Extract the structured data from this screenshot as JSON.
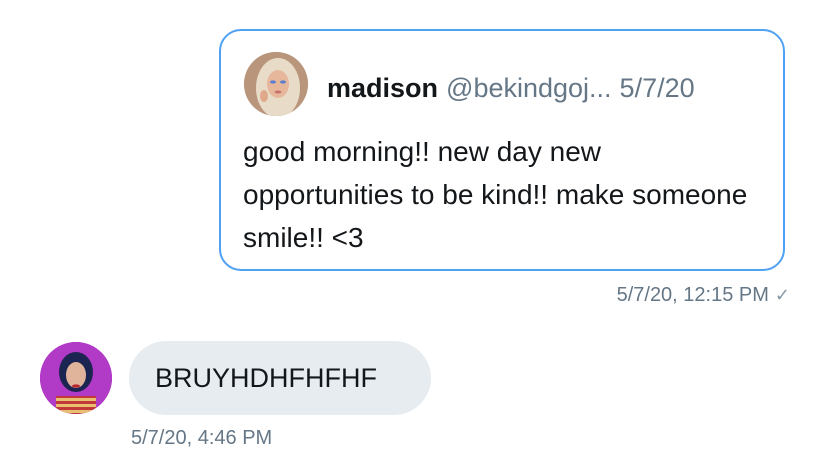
{
  "quoted_tweet": {
    "author_name": "madison",
    "author_handle": "@bekindgoj...",
    "date": "5/7/20",
    "text": "good morning!! new day new opportunities to be kind!! make someone smile!! <3",
    "avatar_icon": "author-avatar-photo"
  },
  "sent_message": {
    "timestamp": "5/7/20, 12:15 PM",
    "status_icon": "checkmark-icon"
  },
  "reply": {
    "text": "BRUYHDHFHFHF",
    "timestamp": "5/7/20, 4:46 PM",
    "avatar_icon": "contact-avatar-photo"
  },
  "colors": {
    "accent_border": "#4ea1f3",
    "bubble_bg": "#e6ecf0",
    "primary_text": "#14171a",
    "secondary_text": "#657786"
  }
}
